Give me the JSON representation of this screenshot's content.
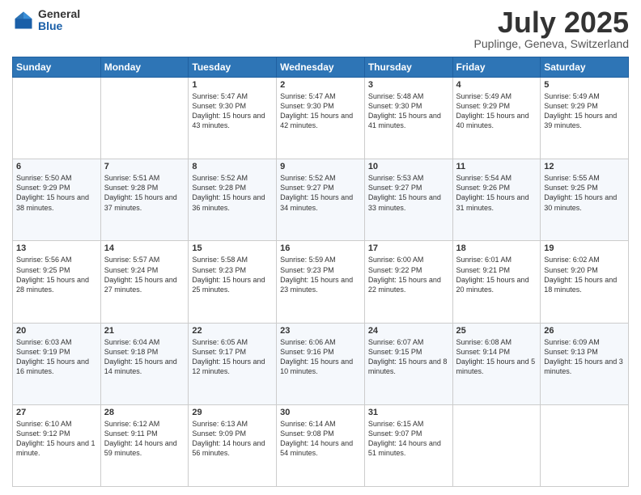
{
  "header": {
    "logo_general": "General",
    "logo_blue": "Blue",
    "month": "July 2025",
    "location": "Puplinge, Geneva, Switzerland"
  },
  "days_of_week": [
    "Sunday",
    "Monday",
    "Tuesday",
    "Wednesday",
    "Thursday",
    "Friday",
    "Saturday"
  ],
  "weeks": [
    [
      {
        "day": "",
        "info": ""
      },
      {
        "day": "",
        "info": ""
      },
      {
        "day": "1",
        "info": "Sunrise: 5:47 AM\nSunset: 9:30 PM\nDaylight: 15 hours and 43 minutes."
      },
      {
        "day": "2",
        "info": "Sunrise: 5:47 AM\nSunset: 9:30 PM\nDaylight: 15 hours and 42 minutes."
      },
      {
        "day": "3",
        "info": "Sunrise: 5:48 AM\nSunset: 9:30 PM\nDaylight: 15 hours and 41 minutes."
      },
      {
        "day": "4",
        "info": "Sunrise: 5:49 AM\nSunset: 9:29 PM\nDaylight: 15 hours and 40 minutes."
      },
      {
        "day": "5",
        "info": "Sunrise: 5:49 AM\nSunset: 9:29 PM\nDaylight: 15 hours and 39 minutes."
      }
    ],
    [
      {
        "day": "6",
        "info": "Sunrise: 5:50 AM\nSunset: 9:29 PM\nDaylight: 15 hours and 38 minutes."
      },
      {
        "day": "7",
        "info": "Sunrise: 5:51 AM\nSunset: 9:28 PM\nDaylight: 15 hours and 37 minutes."
      },
      {
        "day": "8",
        "info": "Sunrise: 5:52 AM\nSunset: 9:28 PM\nDaylight: 15 hours and 36 minutes."
      },
      {
        "day": "9",
        "info": "Sunrise: 5:52 AM\nSunset: 9:27 PM\nDaylight: 15 hours and 34 minutes."
      },
      {
        "day": "10",
        "info": "Sunrise: 5:53 AM\nSunset: 9:27 PM\nDaylight: 15 hours and 33 minutes."
      },
      {
        "day": "11",
        "info": "Sunrise: 5:54 AM\nSunset: 9:26 PM\nDaylight: 15 hours and 31 minutes."
      },
      {
        "day": "12",
        "info": "Sunrise: 5:55 AM\nSunset: 9:25 PM\nDaylight: 15 hours and 30 minutes."
      }
    ],
    [
      {
        "day": "13",
        "info": "Sunrise: 5:56 AM\nSunset: 9:25 PM\nDaylight: 15 hours and 28 minutes."
      },
      {
        "day": "14",
        "info": "Sunrise: 5:57 AM\nSunset: 9:24 PM\nDaylight: 15 hours and 27 minutes."
      },
      {
        "day": "15",
        "info": "Sunrise: 5:58 AM\nSunset: 9:23 PM\nDaylight: 15 hours and 25 minutes."
      },
      {
        "day": "16",
        "info": "Sunrise: 5:59 AM\nSunset: 9:23 PM\nDaylight: 15 hours and 23 minutes."
      },
      {
        "day": "17",
        "info": "Sunrise: 6:00 AM\nSunset: 9:22 PM\nDaylight: 15 hours and 22 minutes."
      },
      {
        "day": "18",
        "info": "Sunrise: 6:01 AM\nSunset: 9:21 PM\nDaylight: 15 hours and 20 minutes."
      },
      {
        "day": "19",
        "info": "Sunrise: 6:02 AM\nSunset: 9:20 PM\nDaylight: 15 hours and 18 minutes."
      }
    ],
    [
      {
        "day": "20",
        "info": "Sunrise: 6:03 AM\nSunset: 9:19 PM\nDaylight: 15 hours and 16 minutes."
      },
      {
        "day": "21",
        "info": "Sunrise: 6:04 AM\nSunset: 9:18 PM\nDaylight: 15 hours and 14 minutes."
      },
      {
        "day": "22",
        "info": "Sunrise: 6:05 AM\nSunset: 9:17 PM\nDaylight: 15 hours and 12 minutes."
      },
      {
        "day": "23",
        "info": "Sunrise: 6:06 AM\nSunset: 9:16 PM\nDaylight: 15 hours and 10 minutes."
      },
      {
        "day": "24",
        "info": "Sunrise: 6:07 AM\nSunset: 9:15 PM\nDaylight: 15 hours and 8 minutes."
      },
      {
        "day": "25",
        "info": "Sunrise: 6:08 AM\nSunset: 9:14 PM\nDaylight: 15 hours and 5 minutes."
      },
      {
        "day": "26",
        "info": "Sunrise: 6:09 AM\nSunset: 9:13 PM\nDaylight: 15 hours and 3 minutes."
      }
    ],
    [
      {
        "day": "27",
        "info": "Sunrise: 6:10 AM\nSunset: 9:12 PM\nDaylight: 15 hours and 1 minute."
      },
      {
        "day": "28",
        "info": "Sunrise: 6:12 AM\nSunset: 9:11 PM\nDaylight: 14 hours and 59 minutes."
      },
      {
        "day": "29",
        "info": "Sunrise: 6:13 AM\nSunset: 9:09 PM\nDaylight: 14 hours and 56 minutes."
      },
      {
        "day": "30",
        "info": "Sunrise: 6:14 AM\nSunset: 9:08 PM\nDaylight: 14 hours and 54 minutes."
      },
      {
        "day": "31",
        "info": "Sunrise: 6:15 AM\nSunset: 9:07 PM\nDaylight: 14 hours and 51 minutes."
      },
      {
        "day": "",
        "info": ""
      },
      {
        "day": "",
        "info": ""
      }
    ]
  ]
}
